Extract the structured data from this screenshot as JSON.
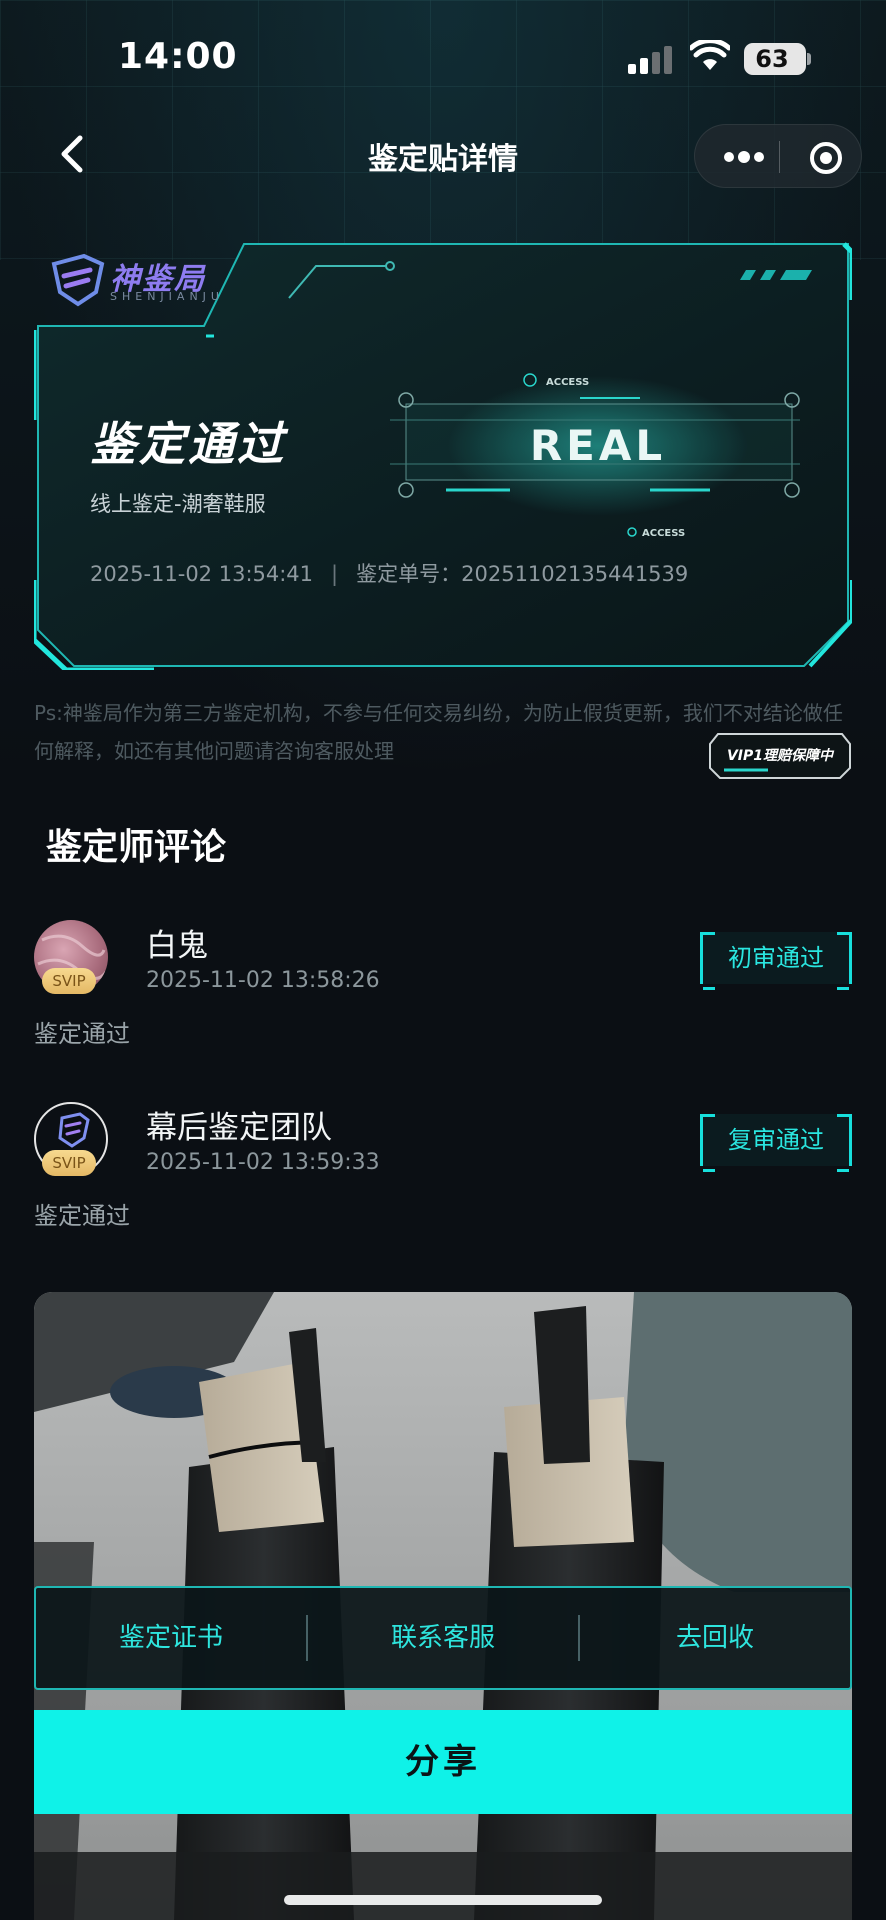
{
  "status_bar": {
    "time": "14:00",
    "battery": "63"
  },
  "nav": {
    "title": "鉴定贴详情",
    "back_icon": "chevron-left-icon",
    "more_icon": "more-dots-icon",
    "target_icon": "target-icon"
  },
  "card": {
    "logo_text": "神鉴局",
    "logo_sub": "SHENJIANJU",
    "result_title": "鉴定通过",
    "result_sub": "线上鉴定-潮奢鞋服",
    "datetime": "2025-11-02 13:54:41",
    "order_label": "鉴定单号：",
    "order_no": "20251102135441539",
    "badge_text": "REAL",
    "badge_access": "ACCESS"
  },
  "disclaimer": "Ps:神鉴局作为第三方鉴定机构，不参与任何交易纠纷，为防止假货更新，我们不对结论做任何解释，如还有其他问题请咨询客服处理",
  "vip_badge": "VIP1理赔保障中",
  "comments_section": {
    "title": "鉴定师评论",
    "items": [
      {
        "name": "白鬼",
        "time": "2025-11-02 13:58:26",
        "badge": "SVIP",
        "body": "鉴定通过",
        "stamp": "初审通过"
      },
      {
        "name": "幕后鉴定团队",
        "time": "2025-11-02 13:59:33",
        "badge": "SVIP",
        "body": "鉴定通过",
        "stamp": "复审通过"
      }
    ]
  },
  "actions": {
    "certificate": "鉴定证书",
    "service": "联系客服",
    "recycle": "去回收",
    "share": "分享"
  },
  "colors": {
    "accent": "#0ff2e8",
    "background": "#0b0f14"
  }
}
